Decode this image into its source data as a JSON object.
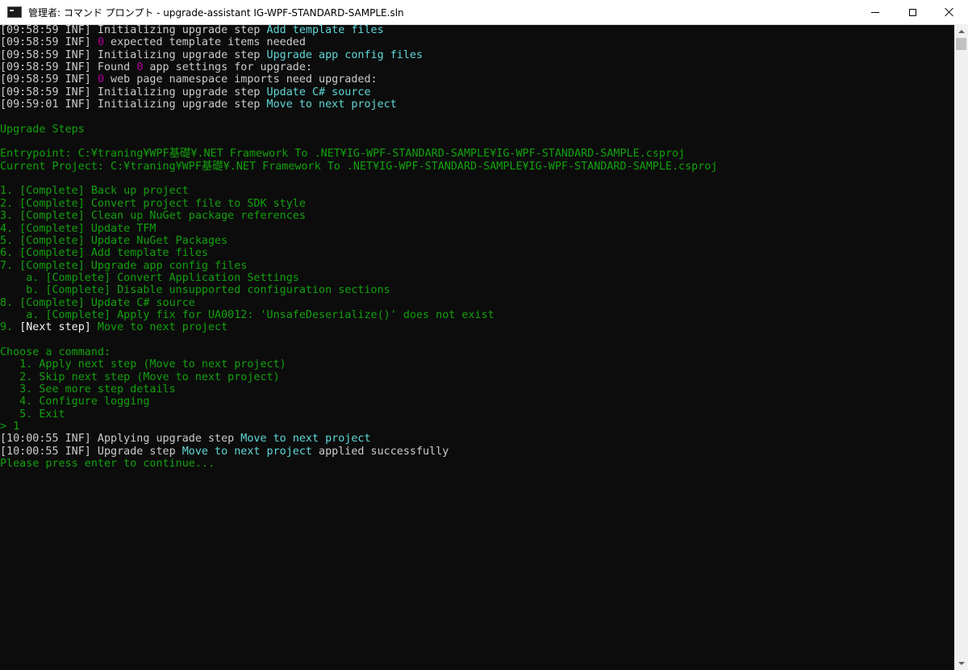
{
  "window": {
    "title": "管理者: コマンド プロンプト - upgrade-assistant  IG-WPF-STANDARD-SAMPLE.sln",
    "app_icon": "cmd-icon",
    "controls": [
      "minimize-icon",
      "maximize-icon",
      "close-icon"
    ]
  },
  "colors": {
    "background": "#0c0c0c",
    "text": "#cccccc",
    "green": "#13a10e",
    "cyan": "#61d6d6",
    "magenta": "#b4009e"
  },
  "console": {
    "lines": [
      [
        {
          "t": "[09:58:59 INF] Initializing upgrade step ",
          "c": "white"
        },
        {
          "t": "Add template files",
          "c": "cyan"
        }
      ],
      [
        {
          "t": "[09:58:59 INF] ",
          "c": "white"
        },
        {
          "t": "0",
          "c": "magenta"
        },
        {
          "t": " expected template items needed",
          "c": "white"
        }
      ],
      [
        {
          "t": "[09:58:59 INF] Initializing upgrade step ",
          "c": "white"
        },
        {
          "t": "Upgrade app config files",
          "c": "cyan"
        }
      ],
      [
        {
          "t": "[09:58:59 INF] Found ",
          "c": "white"
        },
        {
          "t": "0",
          "c": "magenta"
        },
        {
          "t": " app settings for upgrade:",
          "c": "white"
        }
      ],
      [
        {
          "t": "[09:58:59 INF] ",
          "c": "white"
        },
        {
          "t": "0",
          "c": "magenta"
        },
        {
          "t": " web page namespace imports need upgraded:",
          "c": "white"
        }
      ],
      [
        {
          "t": "[09:58:59 INF] Initializing upgrade step ",
          "c": "white"
        },
        {
          "t": "Update C# source",
          "c": "cyan"
        }
      ],
      [
        {
          "t": "[09:59:01 INF] Initializing upgrade step ",
          "c": "white"
        },
        {
          "t": "Move to next project",
          "c": "cyan"
        }
      ],
      [],
      [
        {
          "t": "Upgrade Steps",
          "c": "green"
        }
      ],
      [],
      [
        {
          "t": "Entrypoint: C:¥traning¥WPF基礎¥.NET Framework To .NET¥IG-WPF-STANDARD-SAMPLE¥IG-WPF-STANDARD-SAMPLE.csproj",
          "c": "green"
        }
      ],
      [
        {
          "t": "Current Project: C:¥traning¥WPF基礎¥.NET Framework To .NET¥IG-WPF-STANDARD-SAMPLE¥IG-WPF-STANDARD-SAMPLE.csproj",
          "c": "green"
        }
      ],
      [],
      [
        {
          "t": "1. [Complete] Back up project",
          "c": "green"
        }
      ],
      [
        {
          "t": "2. [Complete] Convert project file to SDK style",
          "c": "green"
        }
      ],
      [
        {
          "t": "3. [Complete] Clean up NuGet package references",
          "c": "green"
        }
      ],
      [
        {
          "t": "4. [Complete] Update TFM",
          "c": "green"
        }
      ],
      [
        {
          "t": "5. [Complete] Update NuGet Packages",
          "c": "green"
        }
      ],
      [
        {
          "t": "6. [Complete] Add template files",
          "c": "green"
        }
      ],
      [
        {
          "t": "7. [Complete] Upgrade app config files",
          "c": "green"
        }
      ],
      [
        {
          "t": "    a. [Complete] Convert Application Settings",
          "c": "green"
        }
      ],
      [
        {
          "t": "    b. [Complete] Disable unsupported configuration sections",
          "c": "green"
        }
      ],
      [
        {
          "t": "8. [Complete] Update C# source",
          "c": "green"
        }
      ],
      [
        {
          "t": "    a. [Complete] Apply fix for UA0012: 'UnsafeDeserialize()' does not exist",
          "c": "green"
        }
      ],
      [
        {
          "t": "9. ",
          "c": "green"
        },
        {
          "t": "[Next step]",
          "c": "bright"
        },
        {
          "t": " Move to next project",
          "c": "green"
        }
      ],
      [],
      [
        {
          "t": "Choose a command:",
          "c": "green"
        }
      ],
      [
        {
          "t": "   1. Apply next step (Move to next project)",
          "c": "green"
        }
      ],
      [
        {
          "t": "   2. Skip next step (Move to next project)",
          "c": "green"
        }
      ],
      [
        {
          "t": "   3. See more step details",
          "c": "green"
        }
      ],
      [
        {
          "t": "   4. Configure logging",
          "c": "green"
        }
      ],
      [
        {
          "t": "   5. Exit",
          "c": "green"
        }
      ],
      [
        {
          "t": "> 1",
          "c": "green"
        }
      ],
      [
        {
          "t": "[10:00:55 INF] Applying upgrade step ",
          "c": "white"
        },
        {
          "t": "Move to next project",
          "c": "cyan"
        }
      ],
      [
        {
          "t": "[10:00:55 INF] Upgrade step ",
          "c": "white"
        },
        {
          "t": "Move to next project",
          "c": "cyan"
        },
        {
          "t": " applied successfully",
          "c": "white"
        }
      ],
      [
        {
          "t": "Please press enter to continue...",
          "c": "green"
        }
      ]
    ]
  }
}
